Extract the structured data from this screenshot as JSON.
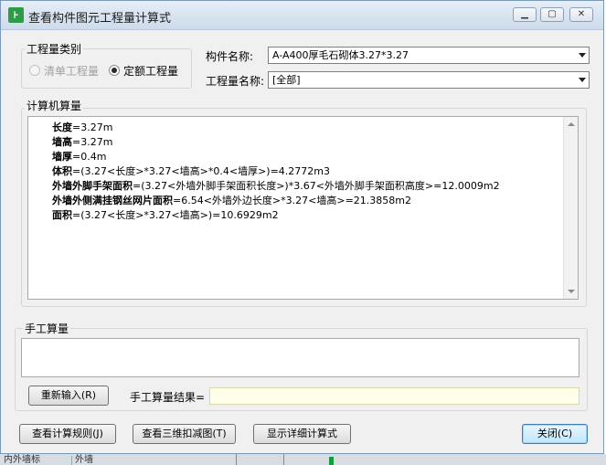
{
  "window": {
    "title": "查看构件图元工程量计算式",
    "app_icon": "app-logo-icon",
    "controls": {
      "minimize": "minimize-icon",
      "maximize": "maximize-icon",
      "close": "close-icon"
    }
  },
  "quantity_type": {
    "group_title": "工程量类别",
    "options": [
      {
        "label": "清单工程量",
        "selected": false,
        "enabled": false
      },
      {
        "label": "定额工程量",
        "selected": true,
        "enabled": true
      }
    ]
  },
  "component": {
    "label": "构件名称:",
    "value": "A-A400厚毛石砌体3.27*3.27"
  },
  "quantity_name": {
    "label": "工程量名称:",
    "value": "[全部]"
  },
  "computer_calc": {
    "group_title": "计算机算量",
    "lines": [
      {
        "name": "长度",
        "expr": "=3.27m"
      },
      {
        "name": "墙高",
        "expr": "=3.27m"
      },
      {
        "name": "墙厚",
        "expr": "=0.4m"
      },
      {
        "name": "体积",
        "expr": "=(3.27<长度>*3.27<墙高>*0.4<墙厚>)=4.2772m3"
      },
      {
        "name": "外墙外脚手架面积",
        "expr": "=(3.27<外墙外脚手架面积长度>)*3.67<外墙外脚手架面积高度>=12.0009m2"
      },
      {
        "name": "外墙外侧满挂钢丝网片面积",
        "expr": "=6.54<外墙外边长度>*3.27<墙高>=21.3858m2"
      },
      {
        "name": "面积",
        "expr": "=(3.27<长度>*3.27<墙高>)=10.6929m2"
      }
    ]
  },
  "manual_calc": {
    "group_title": "手工算量",
    "input_value": "",
    "reenter_button": "重新输入(R)",
    "result_label": "手工算量结果=",
    "result_value": ""
  },
  "footer": {
    "view_rules_button": "查看计算规则(J)",
    "view_3d_button": "查看三维扣减图(T)",
    "show_detail_button": "显示详细计算式",
    "close_button": "关闭(C)"
  },
  "background": {
    "cell_a": "内外墙标",
    "cell_b": "外墙"
  }
}
